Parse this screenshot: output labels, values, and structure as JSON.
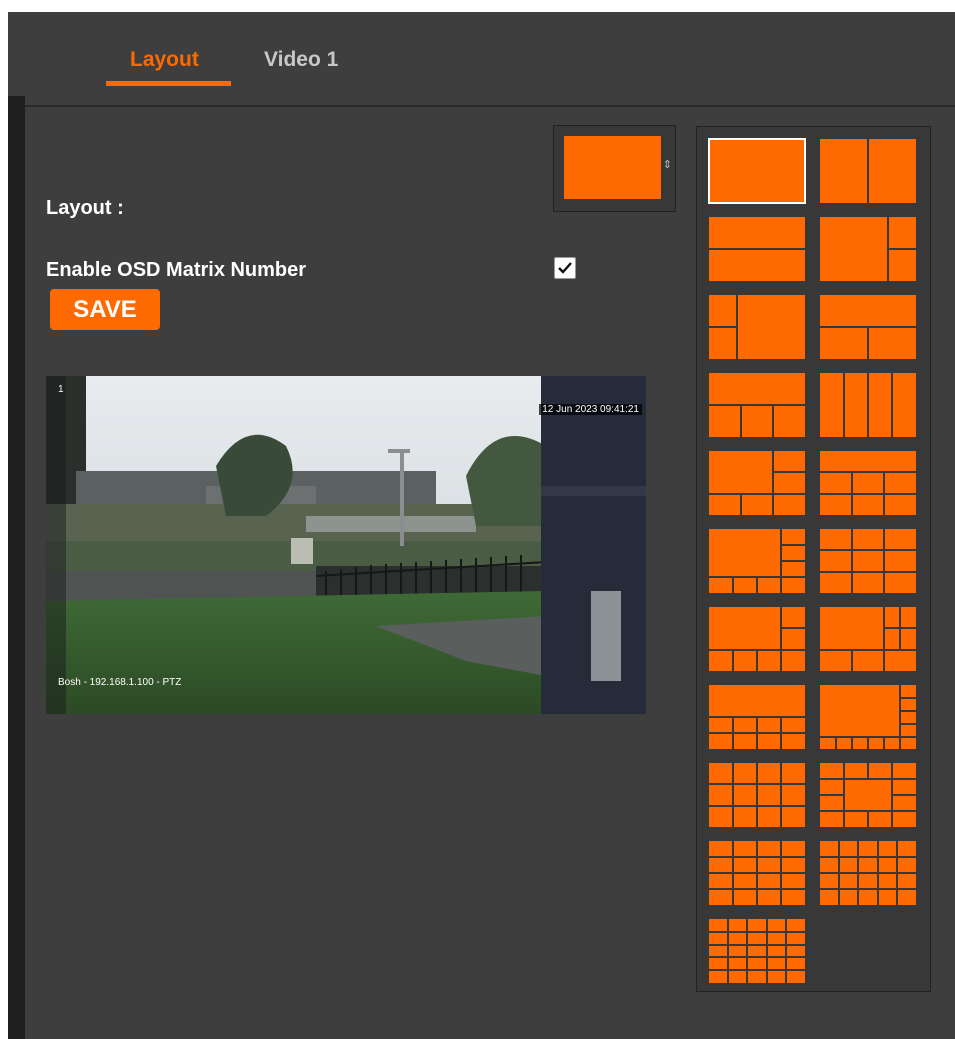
{
  "tabs": [
    {
      "label": "Layout",
      "active": true
    },
    {
      "label": "Video 1",
      "active": false
    }
  ],
  "form": {
    "layout_label": "Layout :",
    "osd_label": "Enable OSD Matrix Number",
    "osd_enabled": true,
    "save_label": "SAVE"
  },
  "video": {
    "channel": "1",
    "timestamp": "12 Jun 2023  09:41:21",
    "camera": "Bosh - 192.168.1.100 - PTZ"
  },
  "colors": {
    "accent": "#ff6a00",
    "background": "#3e3e3e"
  },
  "layouts": [
    {
      "name": "1x1",
      "selected": true
    },
    {
      "name": "1+1 vertical"
    },
    {
      "name": "1+1 horizontal"
    },
    {
      "name": "1+2 right"
    },
    {
      "name": "1+2 left"
    },
    {
      "name": "1+2 split"
    },
    {
      "name": "1+3 bottom"
    },
    {
      "name": "4 columns"
    },
    {
      "name": "1+5"
    },
    {
      "name": "1+6"
    },
    {
      "name": "1+7"
    },
    {
      "name": "2x4"
    },
    {
      "name": "1+7 alt"
    },
    {
      "name": "1+8"
    },
    {
      "name": "1+9"
    },
    {
      "name": "1+12"
    },
    {
      "name": "3x4"
    },
    {
      "name": "1+12 alt"
    },
    {
      "name": "4x4"
    },
    {
      "name": "4x5"
    },
    {
      "name": "5x5"
    }
  ]
}
